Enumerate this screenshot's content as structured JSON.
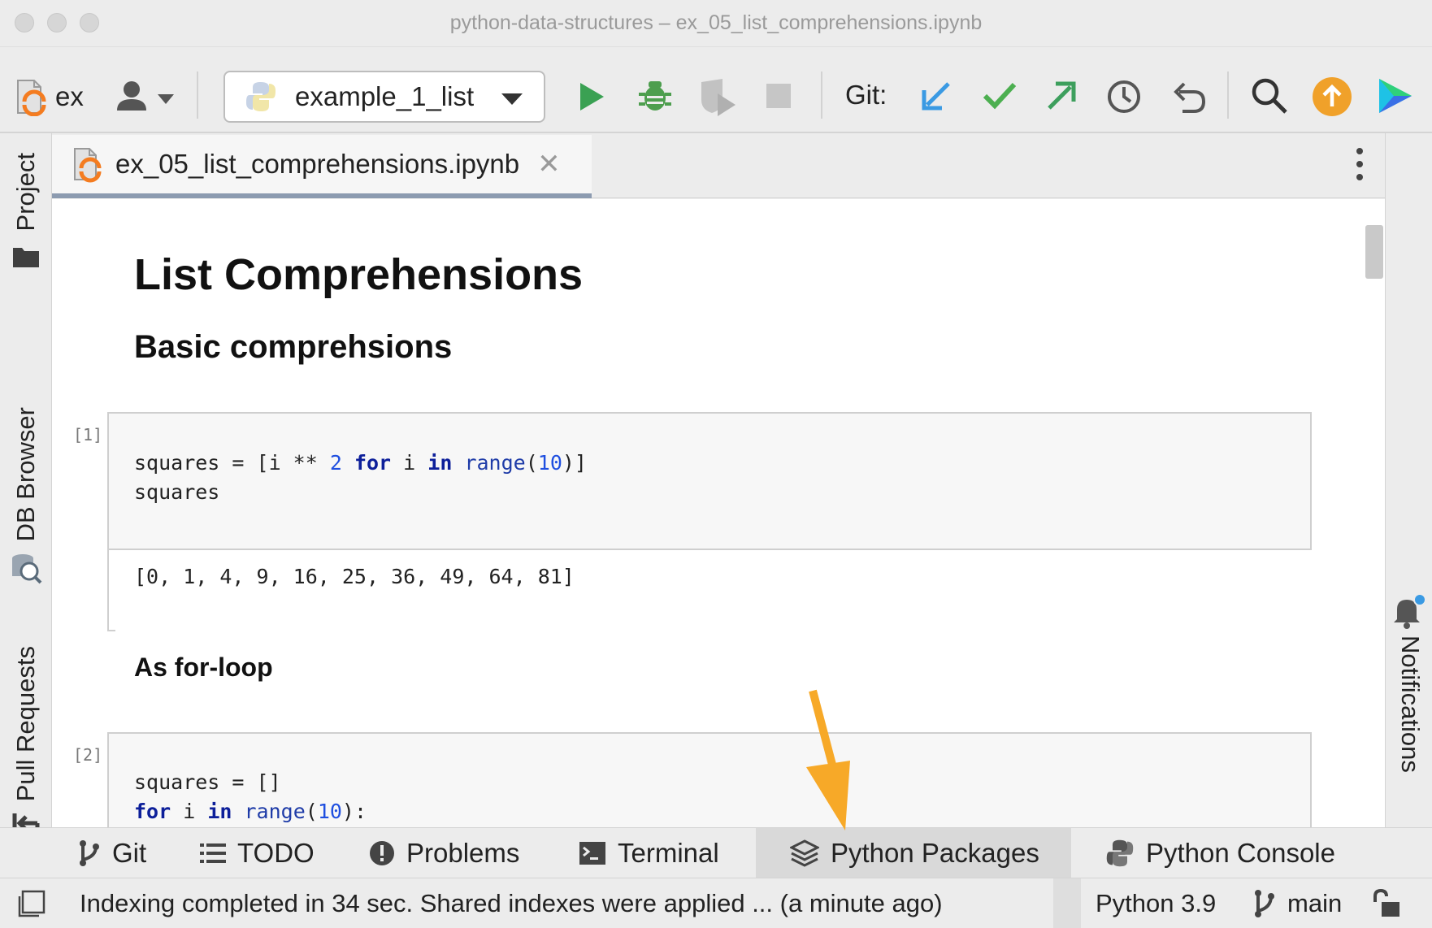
{
  "window": {
    "title": "python-data-structures – ex_05_list_comprehensions.ipynb"
  },
  "toolbar": {
    "project_short": "ex",
    "run_config": "example_1_list",
    "git_label": "Git:"
  },
  "left_tabs": {
    "project": "Project",
    "db_browser": "DB Browser",
    "pull_requests": "Pull Requests"
  },
  "right_tabs": {
    "notifications": "Notifications"
  },
  "editor_tab": {
    "filename": "ex_05_list_comprehensions.ipynb",
    "close": "✕"
  },
  "notebook": {
    "h1": "List Comprehensions",
    "h2": "Basic comprehsions",
    "h3": "As for-loop",
    "cell1": {
      "count": "[1]",
      "output": "[0, 1, 4, 9, 16, 25, 36, 49, 64, 81]"
    },
    "cell2": {
      "count": "[2]"
    }
  },
  "bottom_tools": {
    "git": "Git",
    "todo": "TODO",
    "problems": "Problems",
    "terminal": "Terminal",
    "python_packages": "Python Packages",
    "python_console": "Python Console"
  },
  "status": {
    "message": "Indexing completed in 34 sec. Shared indexes were applied ... (a minute ago)",
    "interpreter": "Python 3.9",
    "branch": "main"
  },
  "colors": {
    "run_green": "#3aa153",
    "debug_green": "#4d9e4e",
    "git_update_blue": "#3a9ae3",
    "git_commit_green": "#4caf50",
    "git_push_green": "#3d9f5d",
    "update_orange": "#f0a12a",
    "annotation_arrow": "#f7a928",
    "keyword": "#0d1f9a",
    "number": "#1f4fe0"
  }
}
